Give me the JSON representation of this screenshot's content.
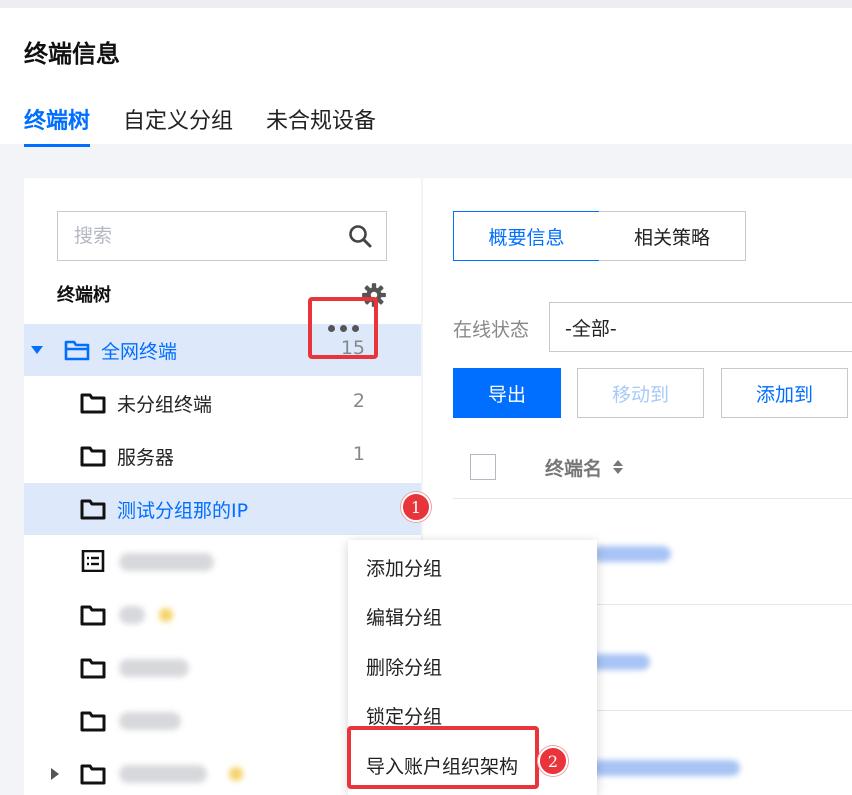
{
  "header": {
    "title": "终端信息",
    "tabs": [
      "终端树",
      "自定义分组",
      "未合规设备"
    ],
    "active_tab": "终端树"
  },
  "sidebar": {
    "search_placeholder": "搜索",
    "tree_title": "终端树",
    "nodes": [
      {
        "label": "全网终端",
        "count": "15"
      },
      {
        "label": "未分组终端",
        "count": "2"
      },
      {
        "label": "服务器",
        "count": "1"
      },
      {
        "label": "测试分组那的IP",
        "count": ""
      }
    ]
  },
  "context_menu": {
    "items": [
      "添加分组",
      "编辑分组",
      "删除分组",
      "锁定分组",
      "导入账户组织架构"
    ]
  },
  "callouts": [
    "1",
    "2"
  ],
  "detail": {
    "tabs": [
      "概要信息",
      "相关策略"
    ],
    "active_tab": "概要信息",
    "filter_label": "在线状态",
    "filter_value": "-全部-",
    "buttons": {
      "export": "导出",
      "move_to": "移动到",
      "add_to": "添加到"
    },
    "column_name": "终端名"
  },
  "colors": {
    "accent": "#006eff",
    "highlight_red": "#e8343b",
    "selected_row": "#dde8fa"
  }
}
